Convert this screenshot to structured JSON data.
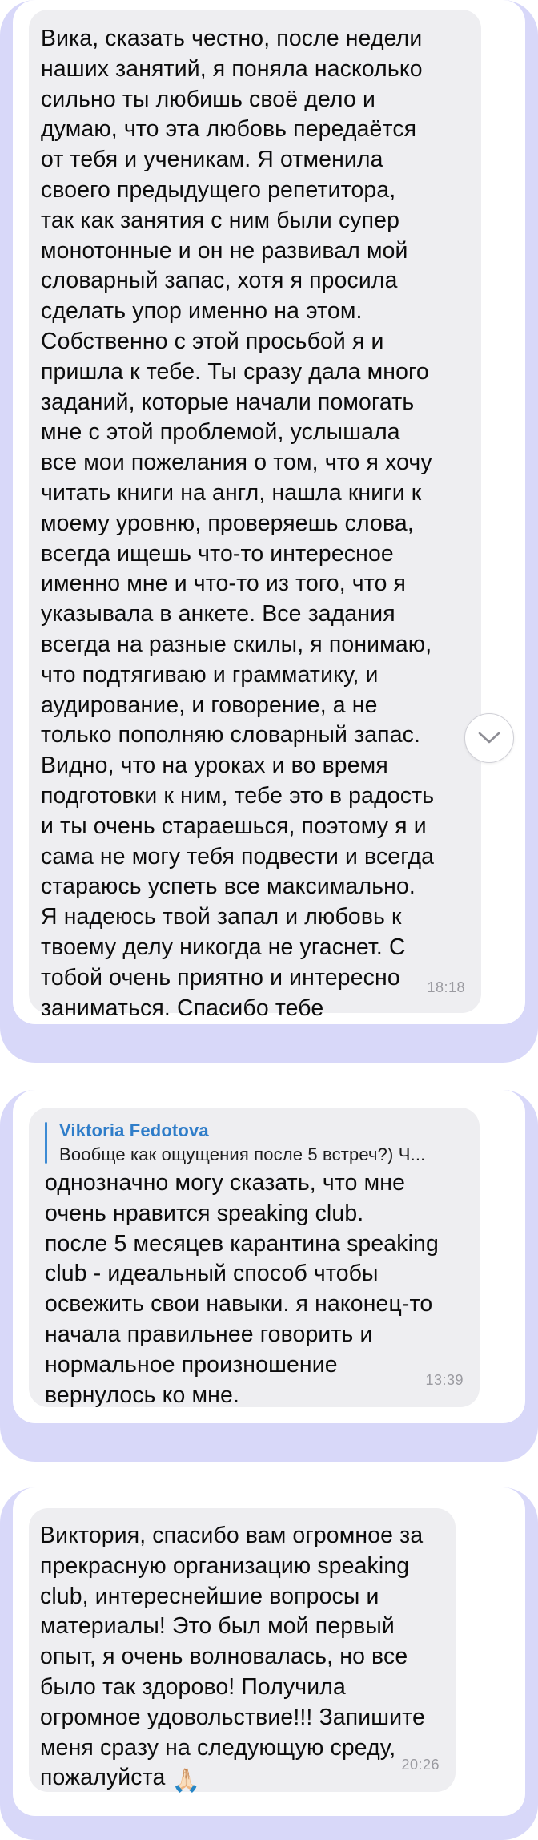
{
  "messages": [
    {
      "text": "Вика, сказать честно, после недели\nнаших занятий, я поняла насколько\nсильно ты любишь своё дело и\nдумаю, что эта любовь передаётся\nот тебя и ученикам. Я отменила\nсвоего предыдущего репетитора,\nтак как занятия с ним были супер\nмонотонные и он не развивал мой\nсловарный запас, хотя я просила\nсделать упор именно на этом.\nСобственно с этой просьбой я и\nпришла к тебе. Ты сразу дала много\nзаданий, которые начали помогать\nмне с этой проблемой, услышала\nвсе мои пожелания о том, что я хочу\nчитать книги на англ, нашла книги к\nмоему уровню, проверяешь слова,\nвсегда ищешь что-то интересное\nименно мне и что-то из того, что я\nуказывала в анкете.  Все задания\nвсегда на разные скилы, я понимаю,\nчто подтягиваю и грамматику, и\nаудирование, и говорение, а не\nтолько пополняю словарный запас.\nВидно, что на уроках и во время\nподготовки к ним, тебе это в радость\nи ты очень стараешься, поэтому я и\nсама не могу тебя подвести и всегда\nстараюсь успеть все максимально.\nЯ надеюсь твой запал и любовь к\nтвоему делу никогда не угаснет. С\nтобой очень приятно и интересно\nзаниматься. Спасибо тебе",
      "time": "18:18"
    },
    {
      "reply_name": "Viktoria Fedotova",
      "reply_text": "Вообще как ощущения после 5 встреч?) Ч...",
      "text": "однозначно могу сказать, что мне\nочень нравится speaking club.\nпосле 5 месяцев карантина speaking\nclub - идеальный способ чтобы\nосвежить свои навыки. я наконец-то\nначала правильнее говорить и\nнормальное произношение\nвернулось ко мне.",
      "time": "13:39"
    },
    {
      "text": "Виктория, спасибо вам огромное за\nпрекрасную организацию speaking\nclub, интереснейшие вопросы и\nматериалы! Это был мой первый\nопыт, я очень волновалась, но все\nбыло так здорово! Получила\nогромное удовольствие!!! Запишите\nменя сразу на следующую среду,\nпожалуйста",
      "emoji": "🙏🏻",
      "time": "20:26"
    }
  ],
  "icons": {
    "scroll_down": "chevron-down-icon",
    "pray": "folded-hands-emoji"
  },
  "colors": {
    "card_background": "#d8d8f9",
    "bubble_background": "#eeeef1",
    "reply_accent": "#3d8bd4"
  }
}
